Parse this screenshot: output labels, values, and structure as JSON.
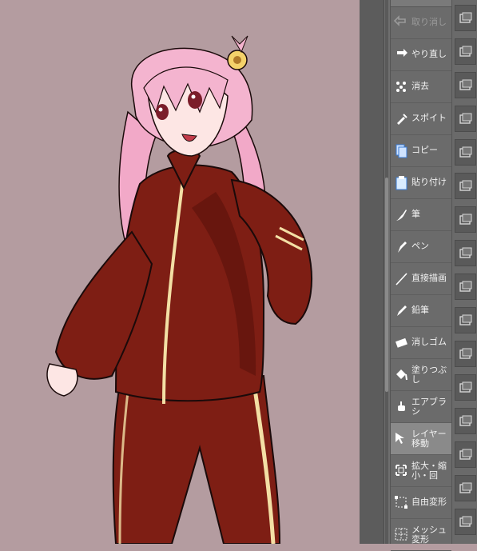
{
  "tools": [
    {
      "label": "取り消し",
      "icon": "undo-icon",
      "enabled": false,
      "selected": false
    },
    {
      "label": "やり直し",
      "icon": "redo-icon",
      "enabled": true,
      "selected": false
    },
    {
      "label": "消去",
      "icon": "erase-icon",
      "enabled": true,
      "selected": false
    },
    {
      "label": "スポイト",
      "icon": "eyedropper-icon",
      "enabled": true,
      "selected": false
    },
    {
      "label": "コピー",
      "icon": "copy-icon",
      "enabled": true,
      "selected": false
    },
    {
      "label": "貼り付け",
      "icon": "paste-icon",
      "enabled": true,
      "selected": false
    },
    {
      "label": "筆",
      "icon": "brush-icon",
      "enabled": true,
      "selected": false
    },
    {
      "label": "ペン",
      "icon": "pen-icon",
      "enabled": true,
      "selected": false
    },
    {
      "label": "直接描画",
      "icon": "line-icon",
      "enabled": true,
      "selected": false
    },
    {
      "label": "鉛筆",
      "icon": "pencil-icon",
      "enabled": true,
      "selected": false
    },
    {
      "label": "消しゴム",
      "icon": "eraser-icon",
      "enabled": true,
      "selected": false
    },
    {
      "label": "塗りつぶし",
      "icon": "fill-bucket-icon",
      "enabled": true,
      "selected": false
    },
    {
      "label": "エアブラシ",
      "icon": "airbrush-icon",
      "enabled": true,
      "selected": false
    },
    {
      "label": "レイヤー移動",
      "icon": "layer-move-icon",
      "enabled": true,
      "selected": true
    },
    {
      "label": "拡大・縮小・回",
      "icon": "scale-rotate-icon",
      "enabled": true,
      "selected": false
    },
    {
      "label": "自由変形",
      "icon": "free-transform-icon",
      "enabled": true,
      "selected": false
    },
    {
      "label": "メッシュ変形",
      "icon": "mesh-transform-icon",
      "enabled": true,
      "selected": false
    }
  ],
  "side_icons": [
    "layer-icon",
    "layer-icon",
    "layer-icon",
    "layer-icon",
    "layer-icon",
    "layer-icon",
    "layer-icon",
    "layer-icon",
    "layer-icon",
    "layer-icon",
    "layer-icon",
    "layer-icon",
    "layer-icon",
    "layer-icon",
    "layer-icon",
    "layer-icon"
  ],
  "colors": {
    "canvas_bg": "#b49ca0",
    "hair": "#f4b4cf",
    "jacket": "#7e1e14",
    "stripe": "#f3dfa5",
    "skin": "#fde6e4",
    "panel": "#6b6b6b"
  }
}
